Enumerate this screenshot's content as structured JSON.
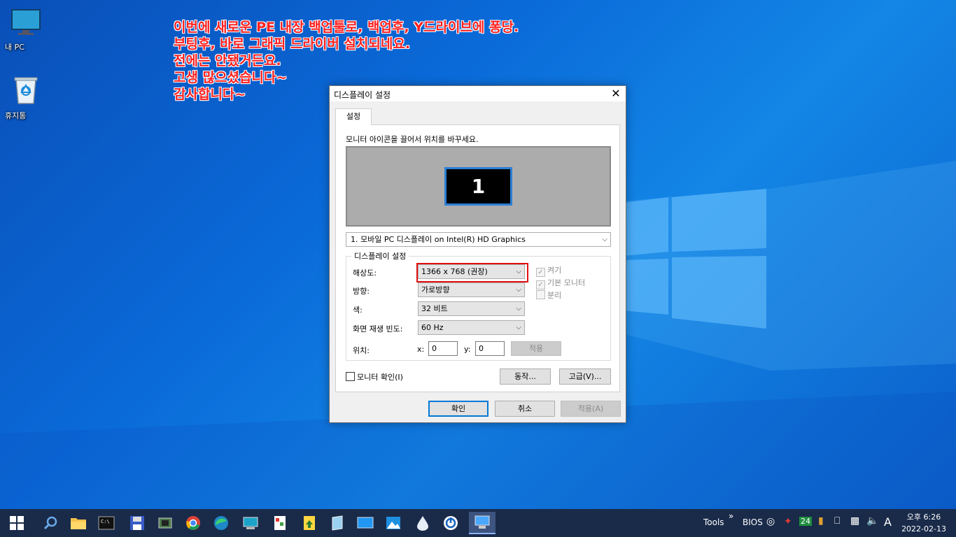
{
  "desktop": {
    "icons": [
      {
        "label": "내 PC",
        "icon": "computer-icon"
      },
      {
        "label": "휴지통",
        "icon": "recycle-bin-icon"
      }
    ],
    "annotation_lines": [
      "이번에 새로운 PE 내장 백업툴로, 백업후, Y드라이브에 퐁당.",
      "부팅후, 바로 그래픽 드라이버 설치되네요.",
      "전에는 안됐거든요.",
      "고생 많으셨습니다~",
      "감사합니다~"
    ],
    "annotation_color": "#ff2020"
  },
  "dialog": {
    "title": "디스플레이 설정",
    "close_glyph": "✕",
    "tab_label": "설정",
    "drag_hint": "모니터 아이콘을 끌어서 위치를 바꾸세요.",
    "monitor_number": "1",
    "monitor_select": "1. 모바일 PC 디스플레이 on Intel(R) HD Graphics",
    "group_label": "디스플레이 설정",
    "resolution_label": "해상도:",
    "resolution_value": "1366 x 768  (권장)",
    "orientation_label": "방향:",
    "orientation_value": "가로방향",
    "color_label": "색:",
    "color_value": "32 비트",
    "refresh_label": "화면 재생 빈도:",
    "refresh_value": "60 Hz",
    "position_label": "위치:",
    "x_label": "x:",
    "x_value": "0",
    "y_label": "y:",
    "y_value": "0",
    "apply_small": "적용",
    "checkboxes": [
      {
        "label": "켜기",
        "checked": true
      },
      {
        "label": "기본 모니터",
        "checked": true
      },
      {
        "label": "분리",
        "checked": false
      }
    ],
    "check_glyph": "✓",
    "identify_label": "모니터 확인(I)",
    "action_button": "동작...",
    "advanced_button": "고급(V)...",
    "ok_button": "확인",
    "cancel_button": "취소",
    "apply_button": "적용(A)",
    "highlight_color": "#e01010"
  },
  "taskbar": {
    "tray_tools": "Tools",
    "tray_chevron": "»",
    "tray_bios": "BIOS",
    "tray_badge": "24",
    "tray_ime": "A",
    "clock_time": "오후 6:26",
    "clock_date": "2022-02-13"
  }
}
